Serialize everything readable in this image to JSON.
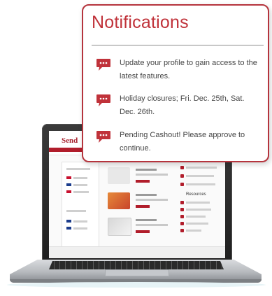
{
  "notifications": {
    "title": "Notifications",
    "items": [
      {
        "icon": "chat-bubble-icon",
        "text": "Update your profile to gain access to the latest features."
      },
      {
        "icon": "chat-bubble-icon",
        "text": "Holiday closures; Fri. Dec. 25th, Sat. Dec. 26th."
      },
      {
        "icon": "chat-bubble-icon",
        "text": "Pending Cashout! Please approve to continue."
      }
    ]
  },
  "laptop_screen": {
    "logo": "Send",
    "resources_title": "Resources"
  },
  "colors": {
    "accent": "#c0323a",
    "border": "#b5343d"
  }
}
